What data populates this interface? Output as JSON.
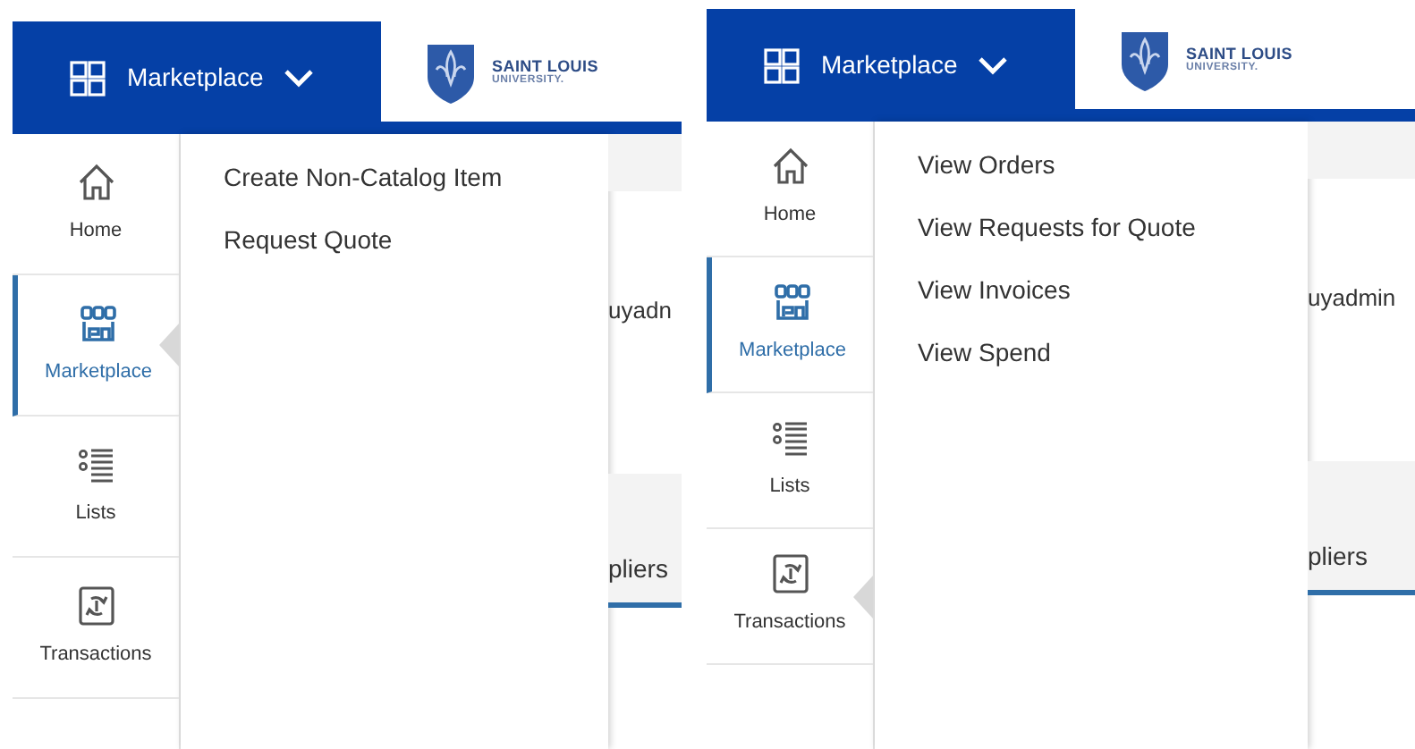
{
  "panels": [
    {
      "header": {
        "menu_label": "Marketplace",
        "logo_line_1": "SAINT LOUIS",
        "logo_line_2": "UNIVERSITY."
      },
      "sidebar": [
        {
          "kind": "home",
          "label": "Home",
          "selected": false,
          "open": false
        },
        {
          "kind": "marketplace",
          "label": "Marketplace",
          "selected": true,
          "open": true
        },
        {
          "kind": "lists",
          "label": "Lists",
          "selected": false,
          "open": false
        },
        {
          "kind": "transactions",
          "label": "Transactions",
          "selected": false,
          "open": false
        }
      ],
      "dropdown": [
        "Create Non-Catalog Item",
        "Request Quote"
      ],
      "background": {
        "user_fragment": "uyadn",
        "tab_fragment": "pliers"
      }
    },
    {
      "header": {
        "menu_label": "Marketplace",
        "logo_line_1": "SAINT LOUIS",
        "logo_line_2": "UNIVERSITY."
      },
      "sidebar": [
        {
          "kind": "home",
          "label": "Home",
          "selected": false,
          "open": false
        },
        {
          "kind": "marketplace",
          "label": "Marketplace",
          "selected": true,
          "open": false
        },
        {
          "kind": "lists",
          "label": "Lists",
          "selected": false,
          "open": false
        },
        {
          "kind": "transactions",
          "label": "Transactions",
          "selected": false,
          "open": true
        }
      ],
      "dropdown": [
        "View Orders",
        "View Requests for Quote",
        "View Invoices",
        "View Spend"
      ],
      "background": {
        "user_fragment": "uyadmin",
        "tab_fragment": "pliers"
      }
    }
  ]
}
